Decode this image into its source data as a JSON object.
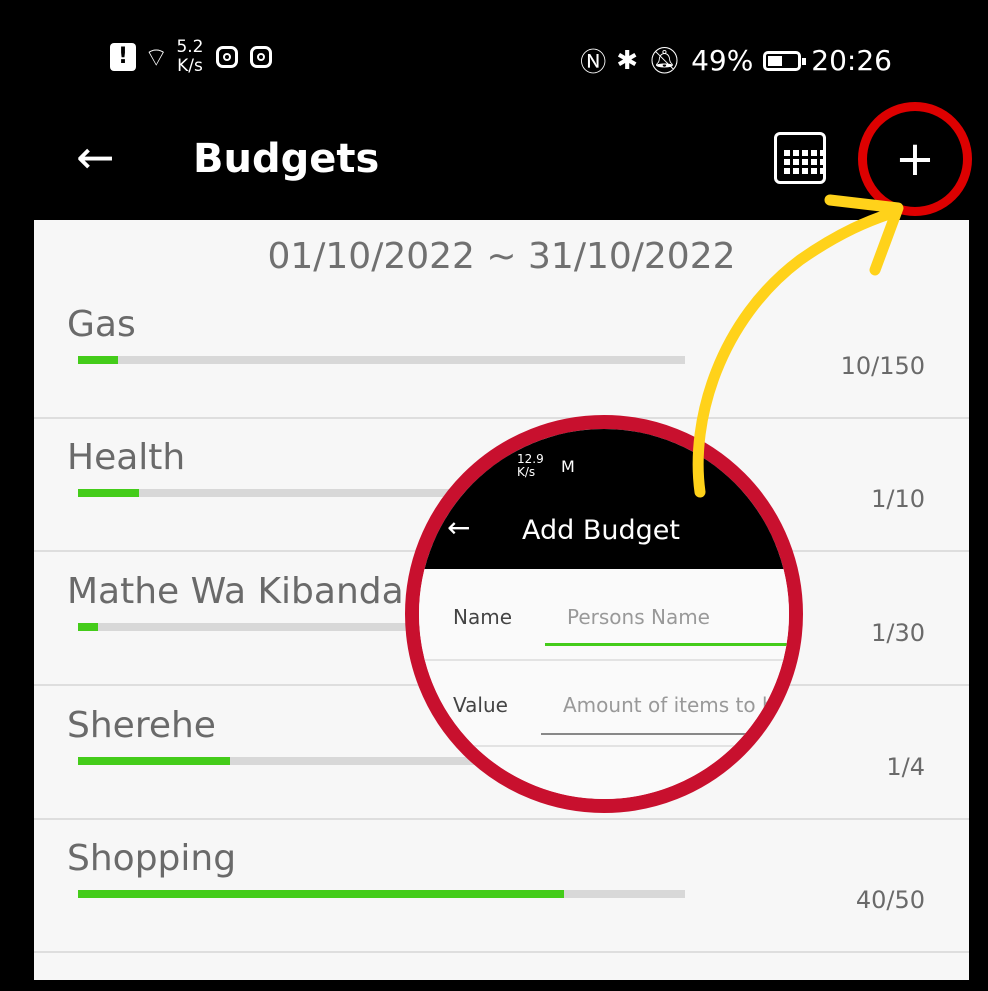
{
  "status": {
    "net_speed": "5.2",
    "net_unit": "K/s",
    "battery": "49%",
    "time": "20:26"
  },
  "appbar": {
    "title": "Budgets",
    "back_icon": "back-arrow-icon",
    "calendar_icon": "calendar-icon",
    "add_icon": "plus-icon"
  },
  "content": {
    "date_range": "01/10/2022 ~ 31/10/2022",
    "budgets": [
      {
        "name": "Gas",
        "value": "10/150",
        "progress": 0.0667
      },
      {
        "name": "Health",
        "value": "1/10",
        "progress": 0.1
      },
      {
        "name": "Mathe Wa Kibanda",
        "value": "1/30",
        "progress": 0.0333
      },
      {
        "name": "Sherehe",
        "value": "1/4",
        "progress": 0.25
      },
      {
        "name": "Shopping",
        "value": "40/50",
        "progress": 0.8
      }
    ]
  },
  "zoom": {
    "net_speed": "12.9",
    "net_unit": "K/s",
    "mail_glyph": "M",
    "title": "Add Budget",
    "name_label": "Name",
    "name_placeholder": "Persons Name",
    "value_label": "Value",
    "value_placeholder": "Amount of items to b"
  },
  "colors": {
    "progress_fill": "#44cc1a",
    "highlight_red": "#c8102e",
    "arrow_yellow": "#ffd21a"
  }
}
